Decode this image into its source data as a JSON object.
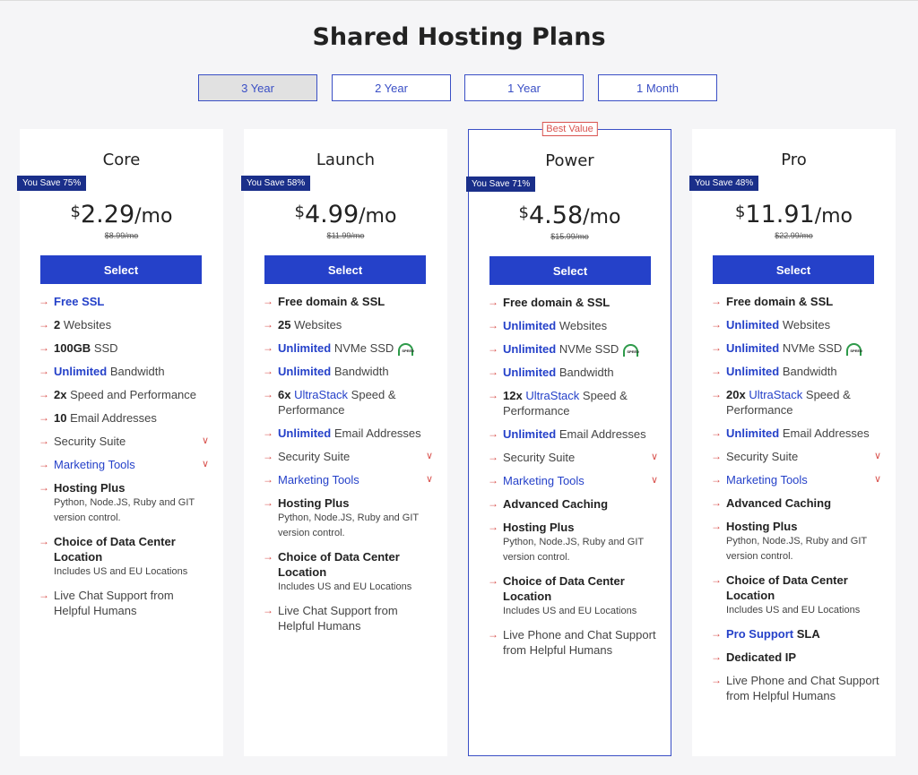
{
  "title": "Shared Hosting Plans",
  "tabs": [
    "3 Year",
    "2 Year",
    "1 Year",
    "1 Month"
  ],
  "active_tab": "3 Year",
  "select_label": "Select",
  "colors": {
    "primary": "#2541c9",
    "dark_badge": "#1a2f8a",
    "arrow": "#d9534f",
    "speed_green": "#2e9a4a"
  },
  "plans": [
    {
      "name": "Core",
      "save": "You Save 75%",
      "currency": "$",
      "amount": "2.29",
      "per": "/mo",
      "orig": "$8.99/mo",
      "features": [
        {
          "html": "<span class='hl'>Free SSL</span>"
        },
        {
          "html": "<b>2</b> Websites"
        },
        {
          "html": "<b>100GB</b> SSD"
        },
        {
          "html": "<span class='hl'>Unlimited</span> Bandwidth"
        },
        {
          "html": "<b>2x</b> Speed and Performance"
        },
        {
          "html": "<b>10</b> Email Addresses"
        },
        {
          "html": "Security Suite",
          "chev": true
        },
        {
          "html": "<span class='ln'>Marketing Tools</span>",
          "chev": true
        },
        {
          "html": "<b>Hosting Plus</b><span class='sub'>Python, Node.JS, Ruby and GIT version control.</span>"
        },
        {
          "html": "<b>Choice of Data Center Location</b><span class='sub'>Includes US and EU Locations</span>"
        },
        {
          "html": "Live Chat Support from Helpful Humans"
        }
      ]
    },
    {
      "name": "Launch",
      "save": "You Save 58%",
      "currency": "$",
      "amount": "4.99",
      "per": "/mo",
      "orig": "$11.99/mo",
      "features": [
        {
          "html": "<b>Free domain &amp; SSL</b>"
        },
        {
          "html": "<b>25</b> Websites"
        },
        {
          "html": "<span class='hl'>Unlimited</span> NVMe SSD",
          "speed": true
        },
        {
          "html": "<span class='hl'>Unlimited</span> Bandwidth"
        },
        {
          "html": "<b>6x</b> <span class='ln'>UltraStack</span> Speed &amp; Performance"
        },
        {
          "html": "<span class='hl'>Unlimited</span> Email Addresses"
        },
        {
          "html": "Security Suite",
          "chev": true
        },
        {
          "html": "<span class='ln'>Marketing Tools</span>",
          "chev": true
        },
        {
          "html": "<b>Hosting Plus</b><span class='sub'>Python, Node.JS, Ruby and GIT version control.</span>"
        },
        {
          "html": "<b>Choice of Data Center Location</b><span class='sub'>Includes US and EU Locations</span>"
        },
        {
          "html": "Live Chat Support from Helpful Humans"
        }
      ]
    },
    {
      "name": "Power",
      "save": "You Save 71%",
      "currency": "$",
      "amount": "4.58",
      "per": "/mo",
      "orig": "$15.99/mo",
      "badge": "Best Value",
      "features": [
        {
          "html": "<b>Free domain &amp; SSL</b>"
        },
        {
          "html": "<span class='hl'>Unlimited</span> Websites"
        },
        {
          "html": "<span class='hl'>Unlimited</span> NVMe SSD",
          "speed": true
        },
        {
          "html": "<span class='hl'>Unlimited</span> Bandwidth"
        },
        {
          "html": "<b>12x</b> <span class='ln'>UltraStack</span> Speed &amp; Performance"
        },
        {
          "html": "<span class='hl'>Unlimited</span> Email Addresses"
        },
        {
          "html": "Security Suite",
          "chev": true
        },
        {
          "html": "<span class='ln'>Marketing Tools</span>",
          "chev": true
        },
        {
          "html": "<b>Advanced Caching</b>"
        },
        {
          "html": "<b>Hosting Plus</b><span class='sub'>Python, Node.JS, Ruby and GIT version control.</span>"
        },
        {
          "html": "<b>Choice of Data Center Location</b><span class='sub'>Includes US and EU Locations</span>"
        },
        {
          "html": "Live Phone and Chat Support from Helpful Humans"
        }
      ]
    },
    {
      "name": "Pro",
      "save": "You Save 48%",
      "currency": "$",
      "amount": "11.91",
      "per": "/mo",
      "orig": "$22.99/mo",
      "features": [
        {
          "html": "<b>Free domain &amp; SSL</b>"
        },
        {
          "html": "<span class='hl'>Unlimited</span> Websites"
        },
        {
          "html": "<span class='hl'>Unlimited</span> NVMe SSD",
          "speed": true
        },
        {
          "html": "<span class='hl'>Unlimited</span> Bandwidth"
        },
        {
          "html": "<b>20x</b> <span class='ln'>UltraStack</span> Speed &amp; Performance"
        },
        {
          "html": "<span class='hl'>Unlimited</span> Email Addresses"
        },
        {
          "html": "Security Suite",
          "chev": true
        },
        {
          "html": "<span class='ln'>Marketing Tools</span>",
          "chev": true
        },
        {
          "html": "<b>Advanced Caching</b>"
        },
        {
          "html": "<b>Hosting Plus</b><span class='sub'>Python, Node.JS, Ruby and GIT version control.</span>"
        },
        {
          "html": "<b>Choice of Data Center Location</b><span class='sub'>Includes US and EU Locations</span>"
        },
        {
          "html": "<span class='hl'>Pro Support</span> <b>SLA</b>"
        },
        {
          "html": "<b>Dedicated IP</b>"
        },
        {
          "html": "Live Phone and Chat Support from Helpful Humans"
        }
      ]
    }
  ]
}
